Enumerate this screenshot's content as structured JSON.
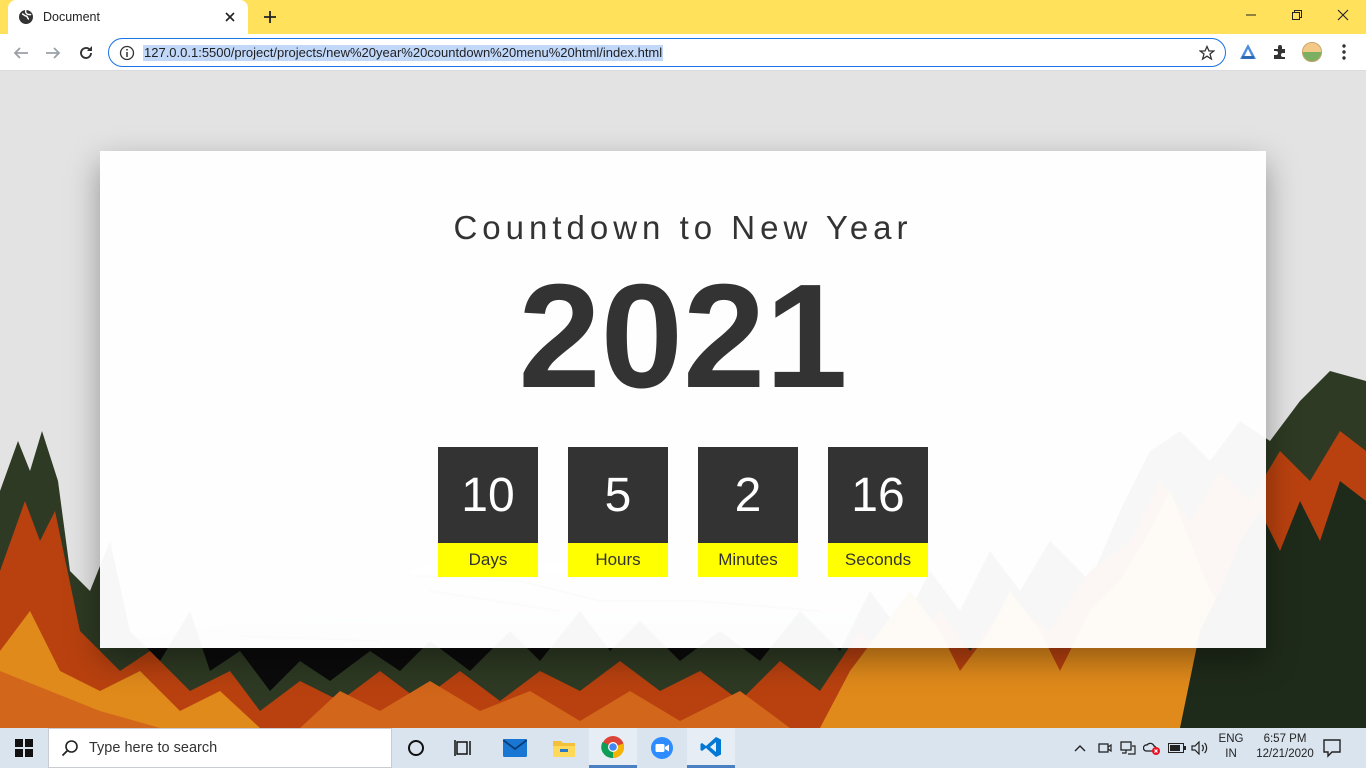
{
  "browser": {
    "tab_title": "Document",
    "url": "127.0.0.1:5500/project/projects/new%20year%20countdown%20menu%20html/index.html",
    "accent": "#ffe15c"
  },
  "page": {
    "heading": "Countdown to New Year",
    "year": "2021",
    "countdown": [
      {
        "value": "10",
        "label": "Days"
      },
      {
        "value": "5",
        "label": "Hours"
      },
      {
        "value": "2",
        "label": "Minutes"
      },
      {
        "value": "16",
        "label": "Seconds"
      }
    ],
    "box_color": "#333333",
    "label_color": "#ffff00"
  },
  "taskbar": {
    "search_placeholder": "Type here to search",
    "apps": [
      "cortana-icon",
      "task-view-icon",
      "mail-icon",
      "file-explorer-icon",
      "chrome-icon",
      "zoom-icon",
      "vscode-icon"
    ],
    "lang_line1": "ENG",
    "lang_line2": "IN",
    "time": "6:57 PM",
    "date": "12/21/2020"
  }
}
